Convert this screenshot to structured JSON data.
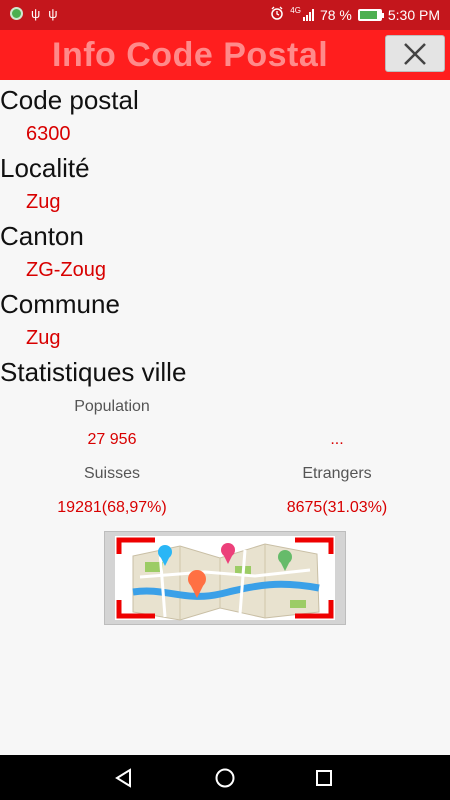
{
  "status_bar": {
    "network": "4G",
    "battery_percent": "78 %",
    "battery_level": 0.78,
    "time": "5:30 PM",
    "icons": [
      "globe-icon",
      "usb-icon",
      "usb-icon",
      "alarm-icon",
      "signal-icon",
      "battery-icon"
    ]
  },
  "header": {
    "title": "Info Code Postal",
    "close_icon": "close-icon"
  },
  "info": {
    "code_postal_label": "Code postal",
    "code_postal_value": "6300",
    "localite_label": "Localité",
    "localite_value": "Zug",
    "canton_label": "Canton",
    "canton_value": "ZG-Zoug",
    "commune_label": "Commune",
    "commune_value": "Zug",
    "stats_label": "Statistiques ville"
  },
  "stats": {
    "population_label": "Population",
    "population_value": "27 956",
    "extra_value": "...",
    "suisses_label": "Suisses",
    "suisses_value": "19281(68,97%)",
    "etrangers_label": "Etrangers",
    "etrangers_value": "8675(31.03%)"
  },
  "map_button": {
    "icon": "map-icon"
  },
  "nav": {
    "icons": [
      "back-icon",
      "home-icon",
      "recents-icon"
    ]
  },
  "colors": {
    "status_bar": "#c4161c",
    "title_bar": "#ff1e1e",
    "title_text": "#ff8a8a",
    "value_red": "#d80000"
  }
}
